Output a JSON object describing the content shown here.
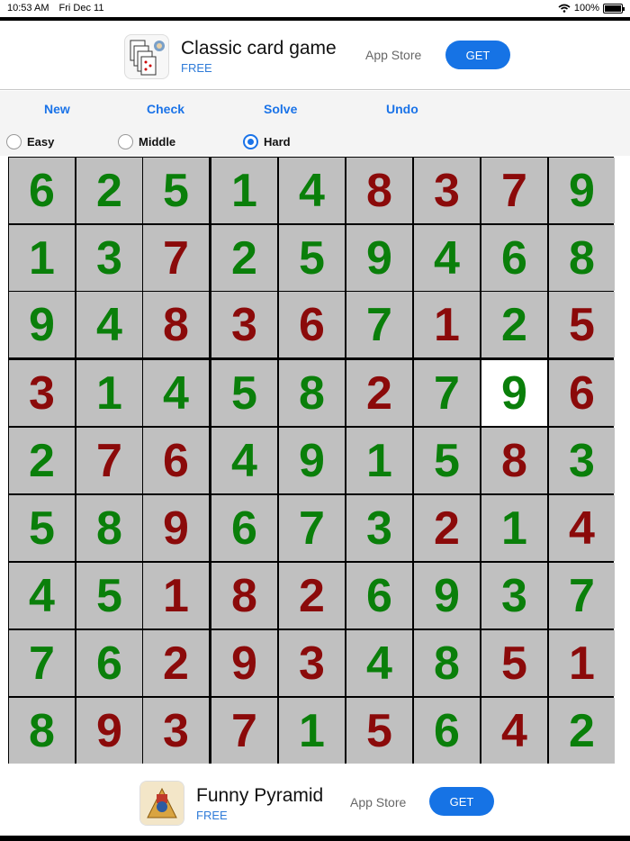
{
  "status_bar": {
    "time": "10:53 AM",
    "date": "Fri Dec 11",
    "battery": "100%",
    "battery_level": 1.0,
    "wifi_icon": "wifi-icon"
  },
  "ads": {
    "top": {
      "title": "Classic card game",
      "price": "FREE",
      "store": "App Store",
      "button": "GET",
      "icon": "playing-cards-icon"
    },
    "bottom": {
      "title": "Funny Pyramid",
      "price": "FREE",
      "store": "App Store",
      "button": "GET",
      "icon": "pyramid-game-icon"
    }
  },
  "toolbar": {
    "new": "New",
    "check": "Check",
    "solve": "Solve",
    "undo": "Undo"
  },
  "difficulty": {
    "options": [
      "Easy",
      "Middle",
      "Hard"
    ],
    "selected": "Hard"
  },
  "board": {
    "rows": [
      [
        6,
        2,
        5,
        1,
        4,
        8,
        3,
        7,
        9
      ],
      [
        1,
        3,
        7,
        2,
        5,
        9,
        4,
        6,
        8
      ],
      [
        9,
        4,
        8,
        3,
        6,
        7,
        1,
        2,
        5
      ],
      [
        3,
        1,
        4,
        5,
        8,
        2,
        7,
        9,
        6
      ],
      [
        2,
        7,
        6,
        4,
        9,
        1,
        5,
        8,
        3
      ],
      [
        5,
        8,
        9,
        6,
        7,
        3,
        2,
        1,
        4
      ],
      [
        4,
        5,
        1,
        8,
        2,
        6,
        9,
        3,
        7
      ],
      [
        7,
        6,
        2,
        9,
        3,
        4,
        8,
        5,
        1
      ],
      [
        8,
        9,
        3,
        7,
        1,
        5,
        6,
        4,
        2
      ]
    ],
    "colors": [
      [
        "g",
        "g",
        "g",
        "g",
        "g",
        "r",
        "r",
        "r",
        "g"
      ],
      [
        "g",
        "g",
        "r",
        "g",
        "g",
        "g",
        "g",
        "g",
        "g"
      ],
      [
        "g",
        "g",
        "r",
        "r",
        "r",
        "g",
        "r",
        "g",
        "r"
      ],
      [
        "r",
        "g",
        "g",
        "g",
        "g",
        "r",
        "g",
        "g",
        "r"
      ],
      [
        "g",
        "r",
        "r",
        "g",
        "g",
        "g",
        "g",
        "r",
        "g"
      ],
      [
        "g",
        "g",
        "r",
        "g",
        "g",
        "g",
        "r",
        "g",
        "r"
      ],
      [
        "g",
        "g",
        "r",
        "r",
        "r",
        "g",
        "g",
        "g",
        "g"
      ],
      [
        "g",
        "g",
        "r",
        "r",
        "r",
        "g",
        "g",
        "r",
        "r"
      ],
      [
        "g",
        "r",
        "r",
        "r",
        "g",
        "r",
        "g",
        "r",
        "g"
      ]
    ],
    "color_values": {
      "given": "#0a7f0a",
      "entered": "#8b0a0a",
      "cell_bg": "#c0c0c0",
      "selected_bg": "#ffffff"
    },
    "selected_cell": [
      3,
      7
    ]
  }
}
